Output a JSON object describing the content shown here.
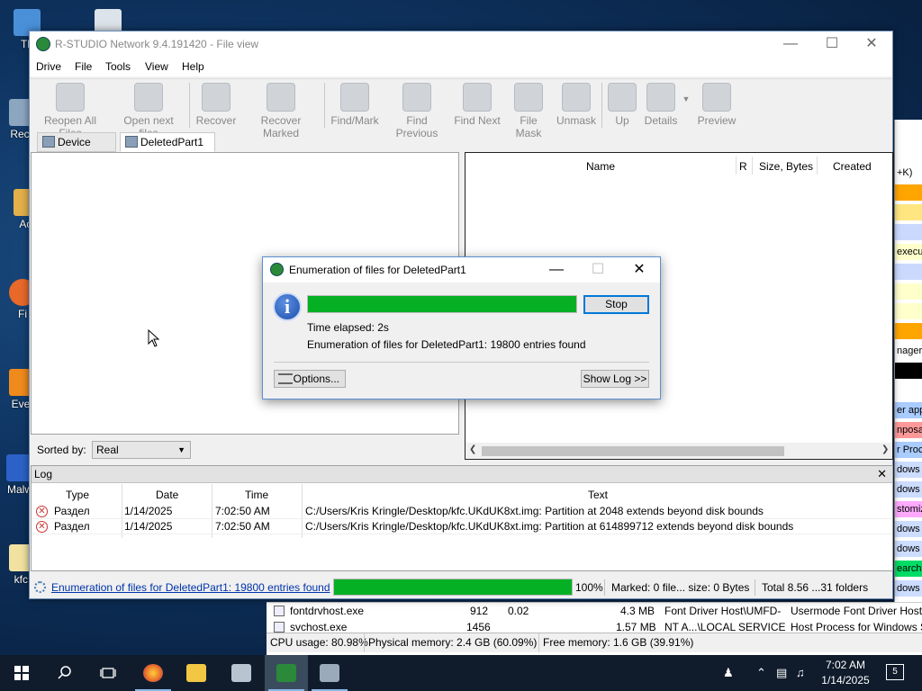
{
  "desktop": {
    "icons": [
      {
        "label": "Th",
        "color": "#4a90d9"
      },
      {
        "label": "Recy",
        "color": "#8da6c0"
      },
      {
        "label": "Act",
        "color": "#e3b04b"
      },
      {
        "label": "Fi",
        "color": "#e8692a"
      },
      {
        "label": "Ever",
        "color": "#f08a1c"
      },
      {
        "label": "Malw",
        "color": "#2c62c8"
      },
      {
        "label": "kfc.",
        "color": "#f2e2a0"
      }
    ]
  },
  "background_window": {
    "strips": [
      {
        "text": "+K)",
        "color": "#ffffff"
      },
      {
        "text": "",
        "color": "#ffa500"
      },
      {
        "text": "",
        "color": "#ffe680"
      },
      {
        "text": "",
        "color": "#ccd9ff"
      },
      {
        "text": "executa",
        "color": "#ffffcc"
      },
      {
        "text": "",
        "color": "#ccd9ff"
      },
      {
        "text": "",
        "color": "#ffffcc"
      },
      {
        "text": "",
        "color": "#ffffcc"
      },
      {
        "text": "",
        "color": "#ffa500"
      },
      {
        "text": "nager",
        "color": "#ffffff"
      },
      {
        "text": "",
        "color": "#000000"
      },
      {
        "text": "",
        "color": "#ffffff"
      },
      {
        "text": "er app",
        "color": "#aaccff"
      },
      {
        "text": "nposab",
        "color": "#ff9999"
      },
      {
        "text": "r Proce",
        "color": "#aaccff"
      },
      {
        "text": "dows S",
        "color": "#ccddff"
      },
      {
        "text": "dows S",
        "color": "#ccddff"
      },
      {
        "text": "stomiz",
        "color": "#ffaaff"
      },
      {
        "text": "dows T",
        "color": "#ccddff"
      },
      {
        "text": "dows S",
        "color": "#ccddff"
      },
      {
        "text": "earch I",
        "color": "#00dd66"
      },
      {
        "text": "dows S",
        "color": "#ccddff"
      }
    ],
    "processes": [
      {
        "name": "fontdrvhost.exe",
        "pid": "912",
        "cpu": "0.02",
        "mem": "4.3 MB",
        "user": "Font Driver Host\\UMFD-",
        "desc": "Usermode Font Driver Host"
      },
      {
        "name": "svchost.exe",
        "pid": "1456",
        "cpu": "",
        "mem": "1.57 MB",
        "user": "NT A...\\LOCAL SERVICE",
        "desc": "Host Process for Windows S"
      }
    ],
    "status": {
      "cpu": "CPU usage: 80.98%",
      "physical": "Physical memory: 2.4 GB (60.09%)",
      "free": "Free memory: 1.6 GB (39.91%)"
    }
  },
  "window": {
    "title": "R-STUDIO Network 9.4.191420 - File view",
    "menu": [
      "Drive",
      "File",
      "Tools",
      "View",
      "Help"
    ],
    "toolbar": [
      {
        "label": "Reopen All Files",
        "icon": "reopen-icon"
      },
      {
        "label": "Open next files",
        "icon": "arrow-right-icon"
      },
      {
        "label": "Recover",
        "icon": "recover-icon"
      },
      {
        "label": "Recover Marked",
        "icon": "recover-marked-icon"
      },
      {
        "label": "Find/Mark",
        "icon": "binoculars-icon"
      },
      {
        "label": "Find Previous",
        "icon": "find-previous-icon"
      },
      {
        "label": "Find Next",
        "icon": "find-next-icon"
      },
      {
        "label": "File Mask",
        "icon": "file-mask-icon"
      },
      {
        "label": "Unmask",
        "icon": "unmask-icon"
      },
      {
        "label": "Up",
        "icon": "folder-up-icon"
      },
      {
        "label": "Details",
        "icon": "details-icon"
      },
      {
        "label": "Preview",
        "icon": "preview-icon"
      }
    ],
    "tabs": [
      {
        "label": "Device view",
        "active": false
      },
      {
        "label": "DeletedPart1",
        "active": true
      }
    ],
    "sorted_by_label": "Sorted by:",
    "sorted_by_value": "Real",
    "file_columns": [
      "Name",
      "R",
      "Size, Bytes",
      "Created"
    ],
    "log": {
      "title": "Log",
      "columns": [
        "Type",
        "Date",
        "Time",
        "Text"
      ],
      "rows": [
        {
          "type": "Раздел",
          "date": "1/14/2025",
          "time": "7:02:50 AM",
          "text": "C:/Users/Kris Kringle/Desktop/kfc.UKdUK8xt.img: Partition at 2048 extends beyond disk bounds"
        },
        {
          "type": "Раздел",
          "date": "1/14/2025",
          "time": "7:02:50 AM",
          "text": "C:/Users/Kris Kringle/Desktop/kfc.UKdUK8xt.img: Partition at 614899712 extends beyond disk bounds"
        }
      ]
    },
    "status": {
      "link": "Enumeration of files for DeletedPart1: 19800 entries found",
      "progress": 1.0,
      "percent": "100%",
      "marked": "Marked: 0 file... size: 0 Bytes",
      "total": "Total 8.56 ...31 folders"
    }
  },
  "dialog": {
    "title": "Enumeration of files for DeletedPart1",
    "progress": 1.0,
    "stop": "Stop",
    "elapsed": "Time elapsed: 2s",
    "enum_text": "Enumeration of files for DeletedPart1: 19800 entries found",
    "options": "Options...",
    "show_log": "Show Log >>"
  },
  "taskbar": {
    "time": "7:02 AM",
    "date": "1/14/2025",
    "notifications": "5"
  },
  "colors": {
    "progress_green": "#06b025",
    "accent_blue": "#0078d7",
    "link_blue": "#0033aa"
  }
}
